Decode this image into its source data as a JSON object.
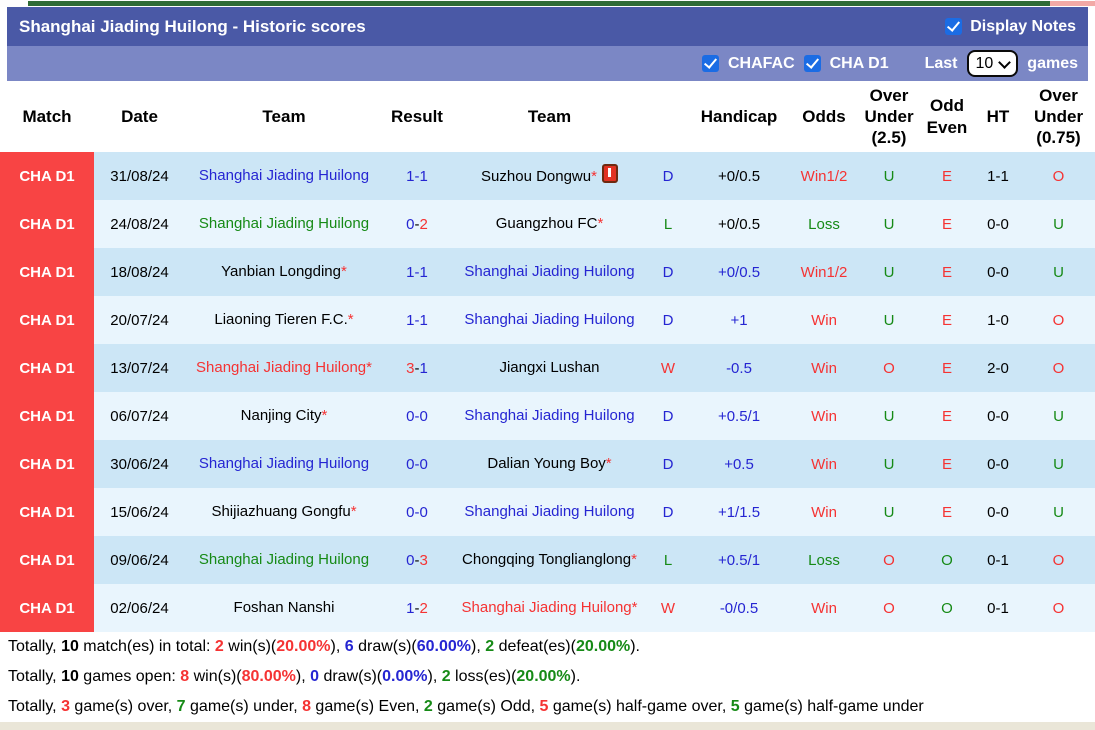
{
  "colors": {
    "black": "#000000",
    "blue": "#2525d2",
    "green": "#168a16",
    "red": "#f53333",
    "league_red": "#f84444",
    "bar_dark": "#4a59a6",
    "bar_light": "#7b87c5",
    "checkbox_blue": "#1b6ce4",
    "row_odd": "#cce6f6",
    "row_even": "#e9f5fd"
  },
  "header_bar": {
    "title": "Shanghai Jiading Huilong - Historic scores",
    "display_notes_label": "Display Notes",
    "display_notes_checked": true
  },
  "filter_bar": {
    "chafac_label": "CHAFAC",
    "chafac_checked": true,
    "chad1_label": "CHA D1",
    "chad1_checked": true,
    "last_label": "Last",
    "games_count": "10",
    "games_label": "games"
  },
  "table": {
    "columns": [
      "Match",
      "Date",
      "Team",
      "Result",
      "Team",
      "",
      "Handicap",
      "Odds",
      "Over Under (2.5)",
      "Odd Even",
      "HT",
      "Over Under (0.75)"
    ],
    "rows": [
      {
        "league": "CHA D1",
        "date": "31/08/24",
        "home": {
          "name": "Shanghai Jiading Huilong",
          "color": "blue",
          "star": false,
          "icon": false
        },
        "score": {
          "home": "1",
          "home_color": "blue",
          "dash_color": "blue",
          "away": "1",
          "away_color": "blue"
        },
        "away": {
          "name": "Suzhou Dongwu",
          "color": "black",
          "star": true,
          "icon": true
        },
        "wdl": {
          "text": "D",
          "color": "blue"
        },
        "handicap": {
          "text": "+0/0.5",
          "color": "black"
        },
        "odds": {
          "text": "Win1/2",
          "color": "red"
        },
        "ou25": {
          "text": "U",
          "color": "green"
        },
        "odd_even": {
          "text": "E",
          "color": "red"
        },
        "ht": "1-1",
        "ou075": {
          "text": "O",
          "color": "red"
        }
      },
      {
        "league": "CHA D1",
        "date": "24/08/24",
        "home": {
          "name": "Shanghai Jiading Huilong",
          "color": "green",
          "star": false,
          "icon": false
        },
        "score": {
          "home": "0",
          "home_color": "blue",
          "dash_color": "black",
          "away": "2",
          "away_color": "red"
        },
        "away": {
          "name": "Guangzhou FC",
          "color": "black",
          "star": true,
          "icon": false
        },
        "wdl": {
          "text": "L",
          "color": "green"
        },
        "handicap": {
          "text": "+0/0.5",
          "color": "black"
        },
        "odds": {
          "text": "Loss",
          "color": "green"
        },
        "ou25": {
          "text": "U",
          "color": "green"
        },
        "odd_even": {
          "text": "E",
          "color": "red"
        },
        "ht": "0-0",
        "ou075": {
          "text": "U",
          "color": "green"
        }
      },
      {
        "league": "CHA D1",
        "date": "18/08/24",
        "home": {
          "name": "Yanbian Longding",
          "color": "black",
          "star": true,
          "icon": false
        },
        "score": {
          "home": "1",
          "home_color": "blue",
          "dash_color": "blue",
          "away": "1",
          "away_color": "blue"
        },
        "away": {
          "name": "Shanghai Jiading Huilong",
          "color": "blue",
          "star": false,
          "icon": false
        },
        "wdl": {
          "text": "D",
          "color": "blue"
        },
        "handicap": {
          "text": "+0/0.5",
          "color": "blue"
        },
        "odds": {
          "text": "Win1/2",
          "color": "red"
        },
        "ou25": {
          "text": "U",
          "color": "green"
        },
        "odd_even": {
          "text": "E",
          "color": "red"
        },
        "ht": "0-0",
        "ou075": {
          "text": "U",
          "color": "green"
        }
      },
      {
        "league": "CHA D1",
        "date": "20/07/24",
        "home": {
          "name": "Liaoning Tieren F.C.",
          "color": "black",
          "star": true,
          "icon": false
        },
        "score": {
          "home": "1",
          "home_color": "blue",
          "dash_color": "blue",
          "away": "1",
          "away_color": "blue"
        },
        "away": {
          "name": "Shanghai Jiading Huilong",
          "color": "blue",
          "star": false,
          "icon": false
        },
        "wdl": {
          "text": "D",
          "color": "blue"
        },
        "handicap": {
          "text": "+1",
          "color": "blue"
        },
        "odds": {
          "text": "Win",
          "color": "red"
        },
        "ou25": {
          "text": "U",
          "color": "green"
        },
        "odd_even": {
          "text": "E",
          "color": "red"
        },
        "ht": "1-0",
        "ou075": {
          "text": "O",
          "color": "red"
        }
      },
      {
        "league": "CHA D1",
        "date": "13/07/24",
        "home": {
          "name": "Shanghai Jiading Huilong",
          "color": "red",
          "star": true,
          "icon": false
        },
        "score": {
          "home": "3",
          "home_color": "red",
          "dash_color": "black",
          "away": "1",
          "away_color": "blue"
        },
        "away": {
          "name": "Jiangxi Lushan",
          "color": "black",
          "star": false,
          "icon": false
        },
        "wdl": {
          "text": "W",
          "color": "red"
        },
        "handicap": {
          "text": "-0.5",
          "color": "blue"
        },
        "odds": {
          "text": "Win",
          "color": "red"
        },
        "ou25": {
          "text": "O",
          "color": "red"
        },
        "odd_even": {
          "text": "E",
          "color": "red"
        },
        "ht": "2-0",
        "ou075": {
          "text": "O",
          "color": "red"
        }
      },
      {
        "league": "CHA D1",
        "date": "06/07/24",
        "home": {
          "name": "Nanjing City",
          "color": "black",
          "star": true,
          "icon": false
        },
        "score": {
          "home": "0",
          "home_color": "blue",
          "dash_color": "blue",
          "away": "0",
          "away_color": "blue"
        },
        "away": {
          "name": "Shanghai Jiading Huilong",
          "color": "blue",
          "star": false,
          "icon": false
        },
        "wdl": {
          "text": "D",
          "color": "blue"
        },
        "handicap": {
          "text": "+0.5/1",
          "color": "blue"
        },
        "odds": {
          "text": "Win",
          "color": "red"
        },
        "ou25": {
          "text": "U",
          "color": "green"
        },
        "odd_even": {
          "text": "E",
          "color": "red"
        },
        "ht": "0-0",
        "ou075": {
          "text": "U",
          "color": "green"
        }
      },
      {
        "league": "CHA D1",
        "date": "30/06/24",
        "home": {
          "name": "Shanghai Jiading Huilong",
          "color": "blue",
          "star": false,
          "icon": false
        },
        "score": {
          "home": "0",
          "home_color": "blue",
          "dash_color": "blue",
          "away": "0",
          "away_color": "blue"
        },
        "away": {
          "name": "Dalian Young Boy",
          "color": "black",
          "star": true,
          "icon": false
        },
        "wdl": {
          "text": "D",
          "color": "blue"
        },
        "handicap": {
          "text": "+0.5",
          "color": "blue"
        },
        "odds": {
          "text": "Win",
          "color": "red"
        },
        "ou25": {
          "text": "U",
          "color": "green"
        },
        "odd_even": {
          "text": "E",
          "color": "red"
        },
        "ht": "0-0",
        "ou075": {
          "text": "U",
          "color": "green"
        }
      },
      {
        "league": "CHA D1",
        "date": "15/06/24",
        "home": {
          "name": "Shijiazhuang Gongfu",
          "color": "black",
          "star": true,
          "icon": false
        },
        "score": {
          "home": "0",
          "home_color": "blue",
          "dash_color": "blue",
          "away": "0",
          "away_color": "blue"
        },
        "away": {
          "name": "Shanghai Jiading Huilong",
          "color": "blue",
          "star": false,
          "icon": false
        },
        "wdl": {
          "text": "D",
          "color": "blue"
        },
        "handicap": {
          "text": "+1/1.5",
          "color": "blue"
        },
        "odds": {
          "text": "Win",
          "color": "red"
        },
        "ou25": {
          "text": "U",
          "color": "green"
        },
        "odd_even": {
          "text": "E",
          "color": "red"
        },
        "ht": "0-0",
        "ou075": {
          "text": "U",
          "color": "green"
        }
      },
      {
        "league": "CHA D1",
        "date": "09/06/24",
        "home": {
          "name": "Shanghai Jiading Huilong",
          "color": "green",
          "star": false,
          "icon": false
        },
        "score": {
          "home": "0",
          "home_color": "blue",
          "dash_color": "black",
          "away": "3",
          "away_color": "red"
        },
        "away": {
          "name": "Chongqing Tonglianglong",
          "color": "black",
          "star": true,
          "icon": false
        },
        "wdl": {
          "text": "L",
          "color": "green"
        },
        "handicap": {
          "text": "+0.5/1",
          "color": "blue"
        },
        "odds": {
          "text": "Loss",
          "color": "green"
        },
        "ou25": {
          "text": "O",
          "color": "red"
        },
        "odd_even": {
          "text": "O",
          "color": "green"
        },
        "ht": "0-1",
        "ou075": {
          "text": "O",
          "color": "red"
        }
      },
      {
        "league": "CHA D1",
        "date": "02/06/24",
        "home": {
          "name": "Foshan Nanshi",
          "color": "black",
          "star": false,
          "icon": false
        },
        "score": {
          "home": "1",
          "home_color": "blue",
          "dash_color": "black",
          "away": "2",
          "away_color": "red"
        },
        "away": {
          "name": "Shanghai Jiading Huilong",
          "color": "red",
          "star": true,
          "icon": false
        },
        "wdl": {
          "text": "W",
          "color": "red"
        },
        "handicap": {
          "text": "-0/0.5",
          "color": "blue"
        },
        "odds": {
          "text": "Win",
          "color": "red"
        },
        "ou25": {
          "text": "O",
          "color": "red"
        },
        "odd_even": {
          "text": "O",
          "color": "green"
        },
        "ht": "0-1",
        "ou075": {
          "text": "O",
          "color": "red"
        }
      }
    ]
  },
  "footer": {
    "lines": [
      [
        {
          "t": "Totally, ",
          "c": "black",
          "b": false
        },
        {
          "t": "10",
          "c": "black",
          "b": true
        },
        {
          "t": " match(es) in total: ",
          "c": "black",
          "b": false
        },
        {
          "t": "2",
          "c": "red",
          "b": true
        },
        {
          "t": " win(s)(",
          "c": "black",
          "b": false
        },
        {
          "t": "20.00%",
          "c": "red",
          "b": true
        },
        {
          "t": "), ",
          "c": "black",
          "b": false
        },
        {
          "t": "6",
          "c": "blue",
          "b": true
        },
        {
          "t": " draw(s)(",
          "c": "black",
          "b": false
        },
        {
          "t": "60.00%",
          "c": "blue",
          "b": true
        },
        {
          "t": "), ",
          "c": "black",
          "b": false
        },
        {
          "t": "2",
          "c": "green",
          "b": true
        },
        {
          "t": " defeat(es)(",
          "c": "black",
          "b": false
        },
        {
          "t": "20.00%",
          "c": "green",
          "b": true
        },
        {
          "t": ").",
          "c": "black",
          "b": false
        }
      ],
      [
        {
          "t": "Totally, ",
          "c": "black",
          "b": false
        },
        {
          "t": "10",
          "c": "black",
          "b": true
        },
        {
          "t": " games open: ",
          "c": "black",
          "b": false
        },
        {
          "t": "8",
          "c": "red",
          "b": true
        },
        {
          "t": " win(s)(",
          "c": "black",
          "b": false
        },
        {
          "t": "80.00%",
          "c": "red",
          "b": true
        },
        {
          "t": "), ",
          "c": "black",
          "b": false
        },
        {
          "t": "0",
          "c": "blue",
          "b": true
        },
        {
          "t": " draw(s)(",
          "c": "black",
          "b": false
        },
        {
          "t": "0.00%",
          "c": "blue",
          "b": true
        },
        {
          "t": "), ",
          "c": "black",
          "b": false
        },
        {
          "t": "2",
          "c": "green",
          "b": true
        },
        {
          "t": " loss(es)(",
          "c": "black",
          "b": false
        },
        {
          "t": "20.00%",
          "c": "green",
          "b": true
        },
        {
          "t": ").",
          "c": "black",
          "b": false
        }
      ],
      [
        {
          "t": "Totally, ",
          "c": "black",
          "b": false
        },
        {
          "t": "3",
          "c": "red",
          "b": true
        },
        {
          "t": " game(s) over, ",
          "c": "black",
          "b": false
        },
        {
          "t": "7",
          "c": "green",
          "b": true
        },
        {
          "t": " game(s) under, ",
          "c": "black",
          "b": false
        },
        {
          "t": "8",
          "c": "red",
          "b": true
        },
        {
          "t": " game(s) Even, ",
          "c": "black",
          "b": false
        },
        {
          "t": "2",
          "c": "green",
          "b": true
        },
        {
          "t": " game(s) Odd, ",
          "c": "black",
          "b": false
        },
        {
          "t": "5",
          "c": "red",
          "b": true
        },
        {
          "t": " game(s) half-game over, ",
          "c": "black",
          "b": false
        },
        {
          "t": "5",
          "c": "green",
          "b": true
        },
        {
          "t": " game(s) half-game under",
          "c": "black",
          "b": false
        }
      ]
    ]
  }
}
